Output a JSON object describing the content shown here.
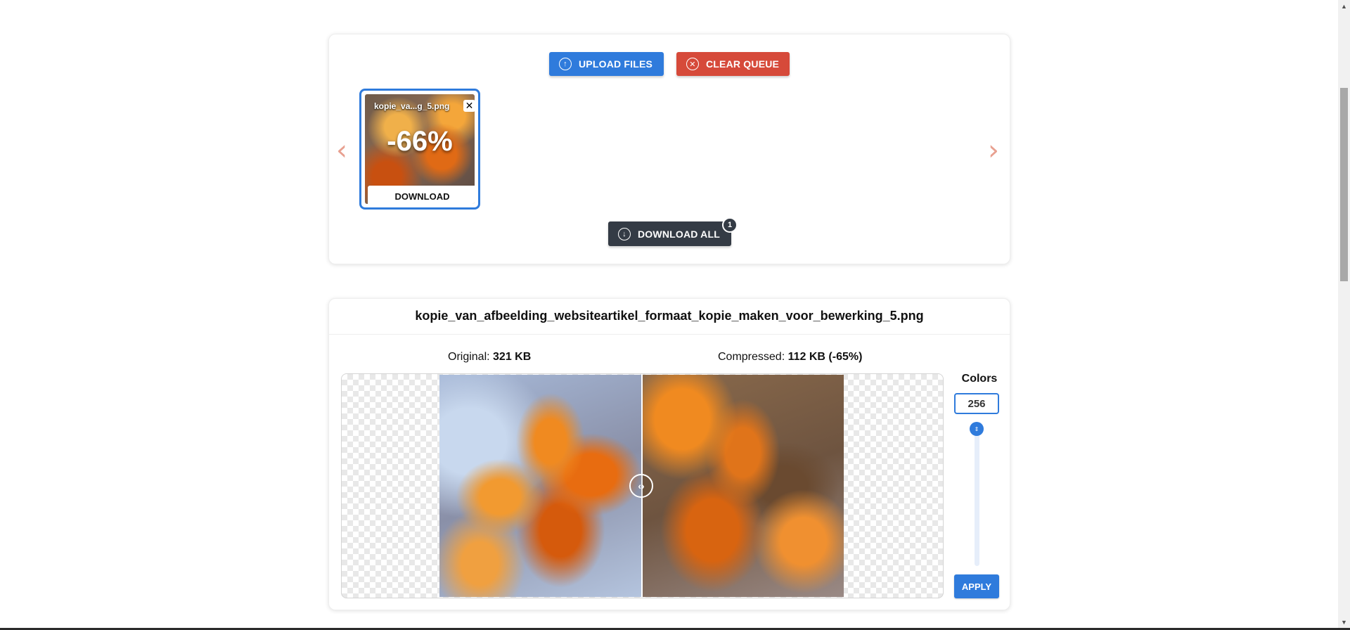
{
  "toolbar": {
    "upload_label": "UPLOAD FILES",
    "upload_icon": "arrow-up-circle-icon",
    "clear_label": "CLEAR QUEUE",
    "clear_icon": "x-circle-icon",
    "download_all_label": "DOWNLOAD ALL",
    "download_all_icon": "arrow-down-circle-icon",
    "download_all_count": "1"
  },
  "queue": {
    "items": [
      {
        "name": "kopie_va...g_5.png",
        "reduction": "-66%",
        "download_label": "DOWNLOAD",
        "close_glyph": "✕"
      }
    ],
    "prev_glyph": "‹",
    "next_glyph": "›"
  },
  "detail": {
    "filename": "kopie_van_afbeelding_websiteartikel_formaat_kopie_maken_voor_bewerking_5.png",
    "original_label": "Original:",
    "original_size": "321 KB",
    "compressed_label": "Compressed:",
    "compressed_size": "112 KB (-65%)",
    "colors_label": "Colors",
    "colors_value": "256",
    "apply_label": "APPLY"
  },
  "colors": {
    "primary": "#2f7bdc",
    "danger": "#d64a3a",
    "dark": "#343b45",
    "arrow": "#e8a090"
  }
}
